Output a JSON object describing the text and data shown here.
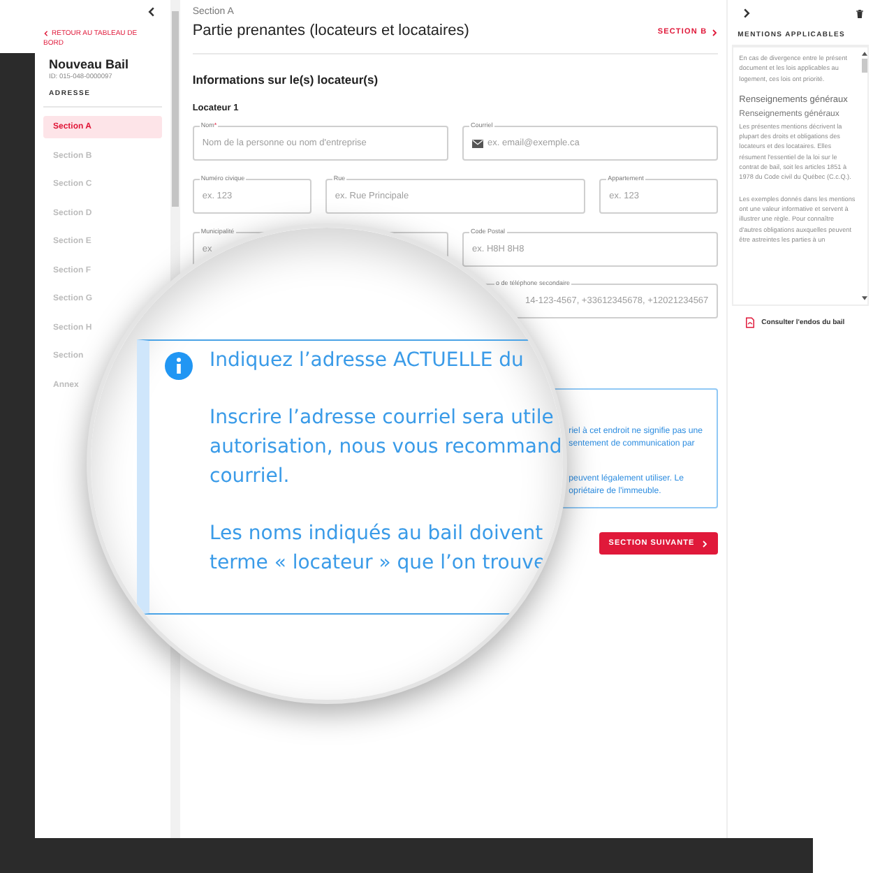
{
  "sidebar": {
    "back_link": "RETOUR AU TABLEAU DE BORD",
    "title": "Nouveau Bail",
    "id": "ID: 015-048-0000097",
    "subtitle": "ADRESSE",
    "items": [
      {
        "label": "Section A",
        "selected": true
      },
      {
        "label": "Section B",
        "selected": false
      },
      {
        "label": "Section C",
        "selected": false
      },
      {
        "label": "Section D",
        "selected": false
      },
      {
        "label": "Section E",
        "selected": false
      },
      {
        "label": "Section F",
        "selected": false
      },
      {
        "label": "Section G",
        "selected": false
      },
      {
        "label": "Section H",
        "selected": false
      },
      {
        "label": "Section",
        "selected": false
      },
      {
        "label": "Annex",
        "selected": false
      }
    ]
  },
  "main": {
    "overline": "Section A",
    "title": "Partie prenantes (locateurs et locataires)",
    "next_link": "SECTION B",
    "heading": "Informations sur le(s) locateur(s)",
    "subheading": "Locateur 1",
    "field_rows": [
      {
        "fields": [
          {
            "kind": "text",
            "label": "Nom",
            "required_mark": "*",
            "placeholder": "Nom de la personne ou nom d'entreprise"
          },
          {
            "kind": "email",
            "label": "Courriel",
            "placeholder": "ex. email@exemple.ca"
          }
        ]
      },
      {
        "fields": [
          {
            "label": "Numéro civique",
            "placeholder": "ex. 123"
          },
          {
            "label": "Rue",
            "placeholder": "ex. Rue Principale"
          },
          {
            "label": "Appartement",
            "placeholder": "ex. 123"
          }
        ]
      },
      {
        "fields": [
          {
            "label": "Municipalité",
            "placeholder": "ex"
          },
          {
            "label": "Code Postal",
            "placeholder": "ex. H8H 8H8"
          }
        ]
      },
      {
        "fields": [
          {
            "label": "o de téléphone secondaire",
            "placeholder": "14-123-4567, +33612345678, +12021234567"
          }
        ]
      }
    ],
    "info_box": {
      "paragraphs": [
        [
          "riel à cet endroit ne signifie pas une",
          "sentement de communication par"
        ],
        [
          "peuvent légalement utiliser. Le",
          "opriétaire de l'immeuble."
        ]
      ]
    },
    "next_button": "SECTION SUIVANTE"
  },
  "right_panel": {
    "title": "MENTIONS APPLICABLES",
    "blocks": [
      {
        "kind": "text",
        "text": "En cas de divergence entre le présent document et les lois applicables au logement, ces lois ont priorité."
      },
      {
        "kind": "heading",
        "text": "Renseignements généraux"
      },
      {
        "kind": "subheading",
        "text": "Renseignements généraux"
      },
      {
        "kind": "text",
        "text": "Les présentes mentions décrivent la plupart des droits et obligations des locateurs et des locataires. Elles résument l'essentiel de la loi sur le contrat de bail, soit les articles 1851 à 1978 du Code civil du Québec (C.c.Q.)."
      },
      {
        "kind": "text",
        "text": "Les exemples donnés dans les mentions ont une valeur informative et servent à illustrer une règle. Pour connaître d'autres obligations auxquelles peuvent être astreintes les parties à un"
      }
    ],
    "link": "Consulter l'endos du bail"
  },
  "magnifier": {
    "paragraphs": [
      [
        "Indiquez l’adresse ACTUELLE du"
      ],
      [
        "Inscrire l’adresse courriel sera utile",
        "autorisation, nous vous recommand",
        "courriel."
      ],
      [
        "Les noms indiqués au bail doivent",
        "terme « locateur » que l’on trouve"
      ]
    ]
  }
}
